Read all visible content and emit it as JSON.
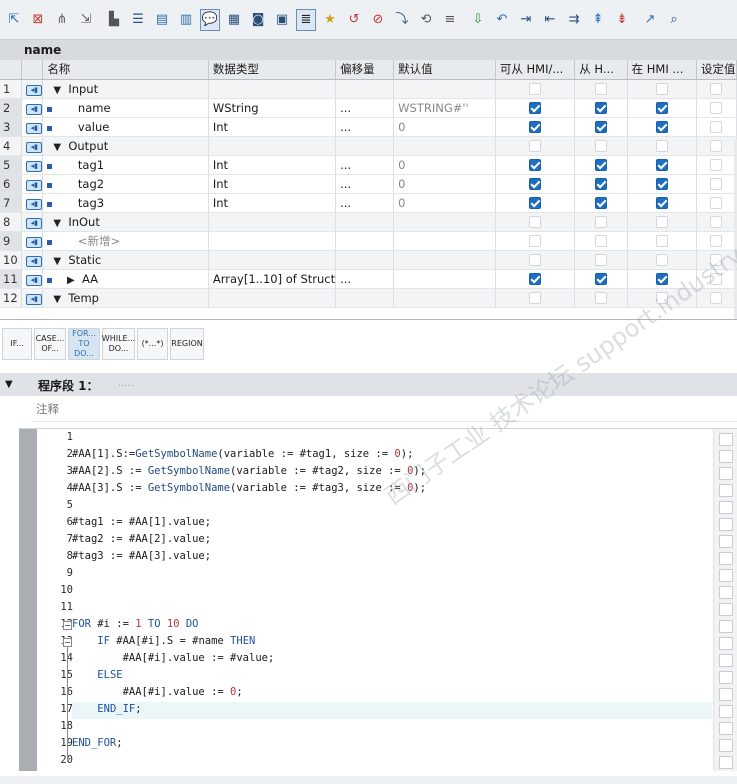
{
  "toolbar": {
    "icons": [
      "insert-row-icon",
      "delete-row-icon",
      "insert-column-icon",
      "expand-icon",
      "navigate-icon",
      "stack-list-icon",
      "block-view-icon",
      "block-interface-icon",
      "comment-icon",
      "monitor-dropdown-icon",
      "snapshot-dropdown-icon",
      "load-dropdown-icon",
      "list-view-icon",
      "favorites-icon",
      "go-to-icon",
      "delete-bookmark-icon",
      "move-icon",
      "replace-icon",
      "replace-all-icon",
      "download-icon",
      "bookmark-prev-icon",
      "indent-icon",
      "outdent-icon",
      "align-icon",
      "first-icon",
      "last-icon",
      "jump-icon",
      "find-icon"
    ]
  },
  "block": {
    "name": "name"
  },
  "table": {
    "headers": [
      "名称",
      "数据类型",
      "偏移量",
      "默认值",
      "可从 HMI/...",
      "从 H...",
      "在 HMI ...",
      "设定值"
    ],
    "rows": [
      {
        "num": "1",
        "kind": "section",
        "name": "Input",
        "type": "",
        "offset": "",
        "default": "",
        "c1": false,
        "c2": false,
        "c3": false,
        "c4": false
      },
      {
        "num": "2",
        "kind": "member",
        "name": "name",
        "type": "WString",
        "offset": "...",
        "default": "WSTRING#''",
        "c1": true,
        "c2": true,
        "c3": true,
        "c4": false
      },
      {
        "num": "3",
        "kind": "member",
        "name": "value",
        "type": "Int",
        "offset": "...",
        "default": "0",
        "c1": true,
        "c2": true,
        "c3": true,
        "c4": false
      },
      {
        "num": "4",
        "kind": "section",
        "name": "Output",
        "type": "",
        "offset": "",
        "default": "",
        "c1": false,
        "c2": false,
        "c3": false,
        "c4": false
      },
      {
        "num": "5",
        "kind": "member",
        "name": "tag1",
        "type": "Int",
        "offset": "...",
        "default": "0",
        "c1": true,
        "c2": true,
        "c3": true,
        "c4": false
      },
      {
        "num": "6",
        "kind": "member",
        "name": "tag2",
        "type": "Int",
        "offset": "...",
        "default": "0",
        "c1": true,
        "c2": true,
        "c3": true,
        "c4": false
      },
      {
        "num": "7",
        "kind": "member",
        "name": "tag3",
        "type": "Int",
        "offset": "...",
        "default": "0",
        "c1": true,
        "c2": true,
        "c3": true,
        "c4": false
      },
      {
        "num": "8",
        "kind": "section",
        "name": "InOut",
        "type": "",
        "offset": "",
        "default": "",
        "c1": false,
        "c2": false,
        "c3": false,
        "c4": false
      },
      {
        "num": "9",
        "kind": "add",
        "name": "<新增>",
        "type": "",
        "offset": "",
        "default": "",
        "c1": false,
        "c2": false,
        "c3": false,
        "c4": false
      },
      {
        "num": "10",
        "kind": "section",
        "name": "Static",
        "type": "",
        "offset": "",
        "default": "",
        "c1": false,
        "c2": false,
        "c3": false,
        "c4": false
      },
      {
        "num": "11",
        "kind": "struct",
        "name": "AA",
        "type": "Array[1..10] of Struct",
        "offset": "...",
        "default": "",
        "c1": true,
        "c2": true,
        "c3": true,
        "c4": false
      },
      {
        "num": "12",
        "kind": "section",
        "name": "Temp",
        "type": "",
        "offset": "",
        "default": "",
        "c1": false,
        "c2": false,
        "c3": false,
        "c4": false
      }
    ]
  },
  "snippets": [
    {
      "label": "IF...",
      "active": false
    },
    {
      "label": "CASE... OF...",
      "active": false
    },
    {
      "label": "FOR... TO DO...",
      "active": true
    },
    {
      "label": "WHILE... DO...",
      "active": false
    },
    {
      "label": "(*...*)",
      "active": false
    },
    {
      "label": "REGION",
      "active": false
    }
  ],
  "network": {
    "title": "程序段 1：",
    "title_extra": ".....",
    "comment": "注释"
  },
  "code": {
    "lines": [
      "",
      "#AA[1].S:=GetSymbolName(variable := #tag1, size := 0);",
      "#AA[2].S := GetSymbolName(variable := #tag2, size := 0);",
      "#AA[3].S := GetSymbolName(variable := #tag3, size := 0);",
      "",
      "#tag1 := #AA[1].value;",
      "#tag2 := #AA[2].value;",
      "#tag3 := #AA[3].value;",
      "",
      "",
      "",
      "FOR #i := 1 TO 10 DO",
      "    IF #AA[#i].S = #name THEN",
      "        #AA[#i].value := #value;",
      "    ELSE",
      "        #AA[#i].value := 0;",
      "    END_IF;",
      "",
      "END_FOR;",
      ""
    ],
    "current_line": 17
  },
  "watermark": "西门子工业 技术论坛 support.industry.siemens.com/cs",
  "colors": {
    "accent": "#1e6fc2",
    "header_bg": "#e8ebee",
    "section_bg": "#f2f4f6"
  }
}
